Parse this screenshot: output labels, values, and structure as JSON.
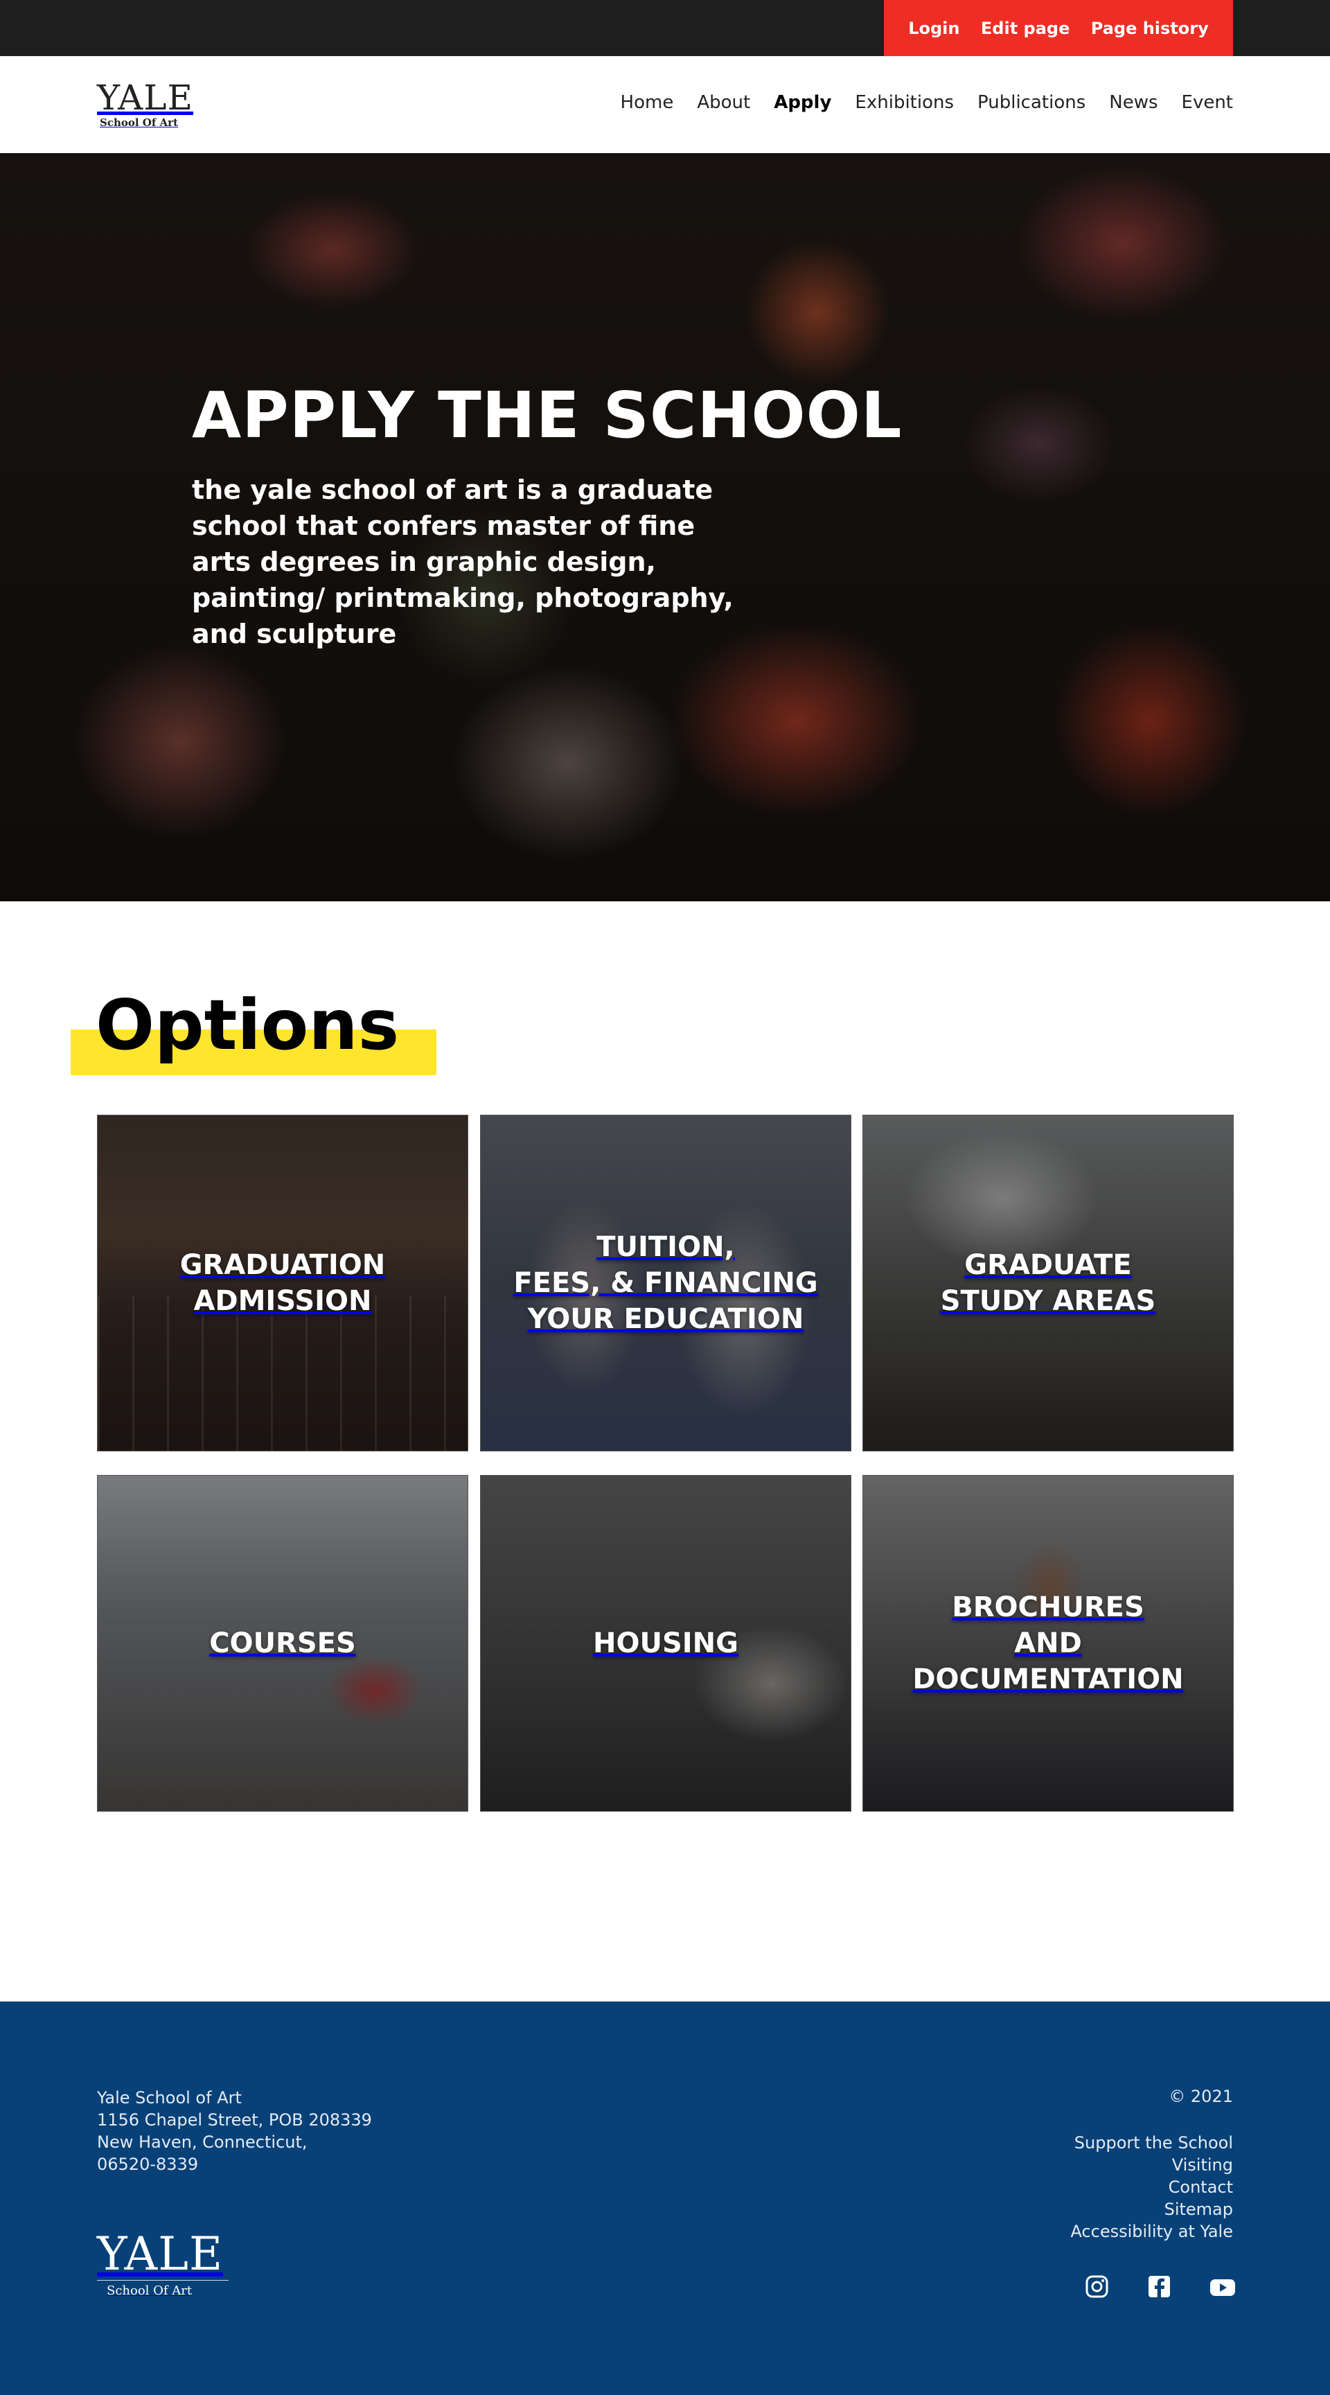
{
  "topbar": {
    "login": "Login",
    "edit_page": "Edit page",
    "page_history": "Page history"
  },
  "logo": {
    "name": "YALE",
    "subtitle": "School Of Art"
  },
  "nav": {
    "items": [
      "Home",
      "About",
      "Apply",
      "Exhibitions",
      "Publications",
      "News",
      "Event"
    ],
    "active": "Apply"
  },
  "hero": {
    "title": "APPLY THE SCHOOL",
    "subtitle": "the yale school of art is a graduate school that confers master of fine arts degrees in graphic design, painting/ printmaking, photography, and sculpture"
  },
  "options": {
    "title": "Options",
    "tiles": [
      "GRADUATION\nADMISSION",
      "TUITION,\nFEES, & FINANCING\nYOUR EDUCATION",
      "GRADUATE\nSTUDY AREAS",
      "COURSES",
      "HOUSING",
      "BROCHURES\nAND\nDOCUMENTATION"
    ]
  },
  "footer": {
    "address": [
      "Yale School of Art",
      "1156 Chapel Street, POB 208339",
      "New Haven, Connecticut,",
      "06520-8339"
    ],
    "copyright": "© 2021",
    "links": [
      "Support the School",
      "Visiting",
      "Contact",
      "Sitemap",
      "Accessibility at Yale"
    ],
    "logo_name": "YALE",
    "logo_subtitle": "School Of Art",
    "socials": [
      "instagram-icon",
      "facebook-icon",
      "youtube-icon"
    ]
  },
  "colors": {
    "topbar_bg": "#1e1e1e",
    "util_red": "#ee2e24",
    "highlight_yellow": "#ffe52e",
    "footer_blue": "#084178"
  }
}
